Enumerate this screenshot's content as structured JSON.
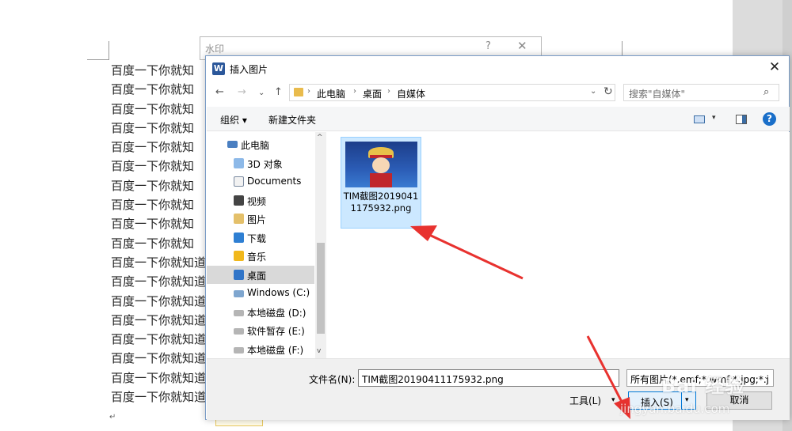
{
  "document": {
    "lines": [
      "百度一下你就知",
      "百度一下你就知",
      "百度一下你就知",
      "百度一下你就知",
      "百度一下你就知",
      "百度一下你就知",
      "百度一下你就知",
      "百度一下你就知",
      "百度一下你就知",
      "百度一下你就知",
      "百度一下你就知道",
      "百度一下你就知道",
      "百度一下你就知道",
      "百度一下你就知道",
      "百度一下你就知道",
      "百度一下你就知道",
      "百度一下你就知道",
      "百度一下你就知道"
    ],
    "para_mark": "↵"
  },
  "watermark_dialog": {
    "title": "水印",
    "help": "?",
    "close": "✕"
  },
  "dialog": {
    "app_icon": "W",
    "title": "插入图片",
    "close": "✕",
    "nav": {
      "back": "←",
      "forward": "→",
      "recent": "⌄",
      "up": "↑",
      "refresh": "↻",
      "dropdown": "⌄"
    },
    "breadcrumbs": [
      "此电脑",
      "桌面",
      "自媒体"
    ],
    "breadcrumb_sep": "›",
    "search_placeholder": "搜索\"自媒体\"",
    "search_icon": "⌕",
    "toolbar": {
      "organize": "组织 ▾",
      "new_folder": "新建文件夹",
      "view_dropdown": "▾",
      "help": "?"
    },
    "nav_tree": [
      {
        "label": "此电脑",
        "icon": "computer-icon"
      },
      {
        "label": "3D 对象",
        "icon": "3d-objects-icon"
      },
      {
        "label": "Documents",
        "icon": "documents-icon"
      },
      {
        "label": "视频",
        "icon": "video-icon"
      },
      {
        "label": "图片",
        "icon": "pictures-icon"
      },
      {
        "label": "下载",
        "icon": "download-icon"
      },
      {
        "label": "音乐",
        "icon": "music-icon"
      },
      {
        "label": "桌面",
        "icon": "desktop-icon",
        "selected": true
      },
      {
        "label": "Windows (C:)",
        "icon": "windows-drive-icon"
      },
      {
        "label": "本地磁盘 (D:)",
        "icon": "drive-icon"
      },
      {
        "label": "软件暂存 (E:)",
        "icon": "drive-icon"
      },
      {
        "label": "本地磁盘 (F:)",
        "icon": "drive-icon"
      }
    ],
    "scroll": {
      "up": "^",
      "down": "v"
    },
    "files": [
      {
        "name": "TIM截图20190411175932.png",
        "selected": true
      }
    ],
    "filename_label": "文件名(N):",
    "filename_value": "TIM截图20190411175932.png",
    "filetype_value": "所有图片(*.emf;*.wmf;*.jpg;*.j",
    "filetype_drop": "⌄",
    "tools_label": "工具(L)",
    "tools_drop": "▾",
    "insert_label": "插入(S)",
    "insert_drop": "▾",
    "cancel_label": "取消"
  },
  "watermark_logo": {
    "text": "Bai 经验",
    "url": "jingyan.baidu.com"
  },
  "colors": {
    "selection": "#cce8ff",
    "accent": "#0078d7",
    "arrow": "#e8322f"
  }
}
